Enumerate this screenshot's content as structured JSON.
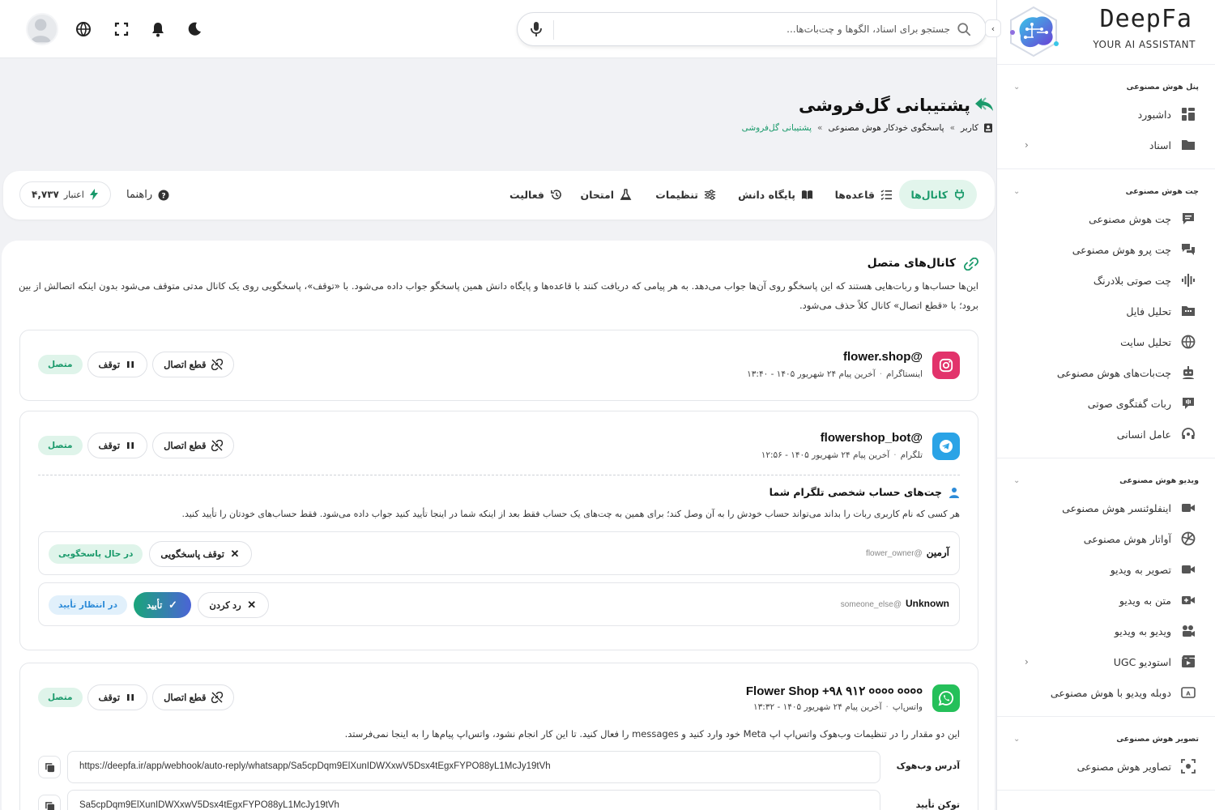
{
  "brand": {
    "name": "DeepFa",
    "tagline": "YOUR AI ASSISTANT"
  },
  "sidebar": {
    "groups": [
      {
        "title": "پنل هوش مصنوعی",
        "items": [
          {
            "label": "داشبورد",
            "icon": "dashboard-icon"
          },
          {
            "label": "اسناد",
            "icon": "folder-icon",
            "has_arrow": true
          }
        ]
      },
      {
        "title": "چت هوش مصنوعی",
        "items": [
          {
            "label": "چت هوش مصنوعی",
            "icon": "chat-icon"
          },
          {
            "label": "چت پرو هوش مصنوعی",
            "icon": "chats-icon"
          },
          {
            "label": "چت صوتی بلادرنگ",
            "icon": "waveform-icon"
          },
          {
            "label": "تحلیل فایل",
            "icon": "file-icon"
          },
          {
            "label": "تحلیل سایت",
            "icon": "globe-icon"
          },
          {
            "label": "چت‌بات‌های هوش مصنوعی",
            "icon": "bot-icon"
          },
          {
            "label": "ربات گفتگوی صوتی",
            "icon": "voice-bot-icon"
          },
          {
            "label": "عامل انسانی",
            "icon": "headset-icon"
          }
        ]
      },
      {
        "title": "ویدیو هوش مصنوعی",
        "items": [
          {
            "label": "اینفلوئنسر هوش مصنوعی",
            "icon": "camera-icon"
          },
          {
            "label": "آواتار هوش مصنوعی",
            "icon": "avatar-icon"
          },
          {
            "label": "تصویر به ویدیو",
            "icon": "video-icon"
          },
          {
            "label": "متن به ویدیو",
            "icon": "video-plus-icon"
          },
          {
            "label": "ویدیو به ویدیو",
            "icon": "video-swap-icon"
          },
          {
            "label": "استودیو UGC",
            "icon": "studio-icon",
            "has_arrow": true
          },
          {
            "label": "دوبله ویدیو با هوش مصنوعی",
            "icon": "dub-icon"
          }
        ]
      },
      {
        "title": "تصویر هوش مصنوعی",
        "items": [
          {
            "label": "تصاویر هوش مصنوعی",
            "icon": "image-icon"
          }
        ]
      }
    ]
  },
  "topbar": {
    "search_placeholder": "جستجو برای اسناد، الگوها و چت‌بات‌ها..."
  },
  "header": {
    "title": "پشتیبانی گل‌فروشی",
    "breadcrumb": [
      "کاربر",
      "پاسخگوی خودکار هوش مصنوعی",
      "پشتیبانی گل‌فروشی"
    ]
  },
  "tabs": [
    {
      "label": "کانال‌ها",
      "icon": "plug-icon",
      "active": true
    },
    {
      "label": "قاعده‌ها",
      "icon": "list-icon"
    },
    {
      "label": "پایگاه دانش",
      "icon": "book-icon"
    },
    {
      "label": "تنظیمات",
      "icon": "sliders-icon"
    },
    {
      "label": "امتحان",
      "icon": "flask-icon"
    },
    {
      "label": "فعالیت",
      "icon": "history-icon"
    }
  ],
  "toolbar": {
    "help_label": "راهنما",
    "credit_label": "اعتبار",
    "credit_value": "۴,۷۳۷"
  },
  "section": {
    "title": "کانال‌های متصل",
    "desc": "این‌ها حساب‌ها و ربات‌هایی هستند که این پاسخگو روی آن‌ها جواب می‌دهد. به هر پیامی که دریافت کنند با قاعده‌ها و پایگاه دانش همین پاسخگو جواب داده می‌شود. با «توقف»، پاسخگویی روی یک کانال مدتی متوقف می‌شود بدون اینکه اتصالش از بین برود؛ با «قطع اتصال» کانال کلاً حذف می‌شود."
  },
  "status_connected": "متصل",
  "pause_label": "توقف",
  "disconnect_label": "قطع اتصال",
  "channels": [
    {
      "name": "@flower.shop",
      "platform": "اینستاگرام",
      "last_msg": "آخرین پیام ۲۴ شهریور ۱۴۰۵ - ۱۳:۴۰",
      "color": "#e2336b"
    },
    {
      "name": "@flowershop_bot",
      "platform": "تلگرام",
      "last_msg": "آخرین پیام ۲۴ شهریور ۱۴۰۵ - ۱۲:۵۶",
      "color": "#2aa3e6"
    },
    {
      "name": "Flower Shop +۹۸ ۹۱۲ ०००० ००००",
      "platform": "واتس‌اپ",
      "last_msg": "آخرین پیام ۲۴ شهریور ۱۴۰۵ - ۱۳:۳۲",
      "color": "#25c05a"
    }
  ],
  "telegram_personal": {
    "title": "چت‌های حساب شخصی تلگرام شما",
    "desc": "هر کسی که نام کاربری ربات را بداند می‌تواند حساب خودش را به آن وصل کند؛ برای همین به چت‌های یک حساب فقط بعد از اینکه شما در اینجا تأیید کنید جواب داده می‌شود. فقط حساب‌های خودتان را تأیید کنید.",
    "accounts": [
      {
        "name": "آرمین",
        "handle": "@flower_owner",
        "status": "در حال پاسخگویی",
        "action": "توقف پاسخگویی"
      },
      {
        "name": "Unknown",
        "handle": "@someone_else",
        "status": "در انتظار تأیید",
        "approve": "تأیید",
        "reject": "رد کردن"
      }
    ]
  },
  "whatsapp": {
    "desc": "این دو مقدار را در تنظیمات وب‌هوک واتس‌اپ اپ Meta خود وارد کنید و messages را فعال کنید. تا این کار انجام نشود، واتس‌اپ پیام‌ها را به اینجا نمی‌فرستد.",
    "webhook_label": "آدرس وب‌هوک",
    "webhook_value": "https://deepfa.ir/app/webhook/auto-reply/whatsapp/Sa5cpDqm9ElXunIDWXxwV5Dsx4tEgxFYPO88yL1McJy19tVh",
    "token_label": "توکن تأیید",
    "token_value": "Sa5cpDqm9ElXunIDWXxwV5Dsx4tEgxFYPO88yL1McJy19tVh"
  }
}
